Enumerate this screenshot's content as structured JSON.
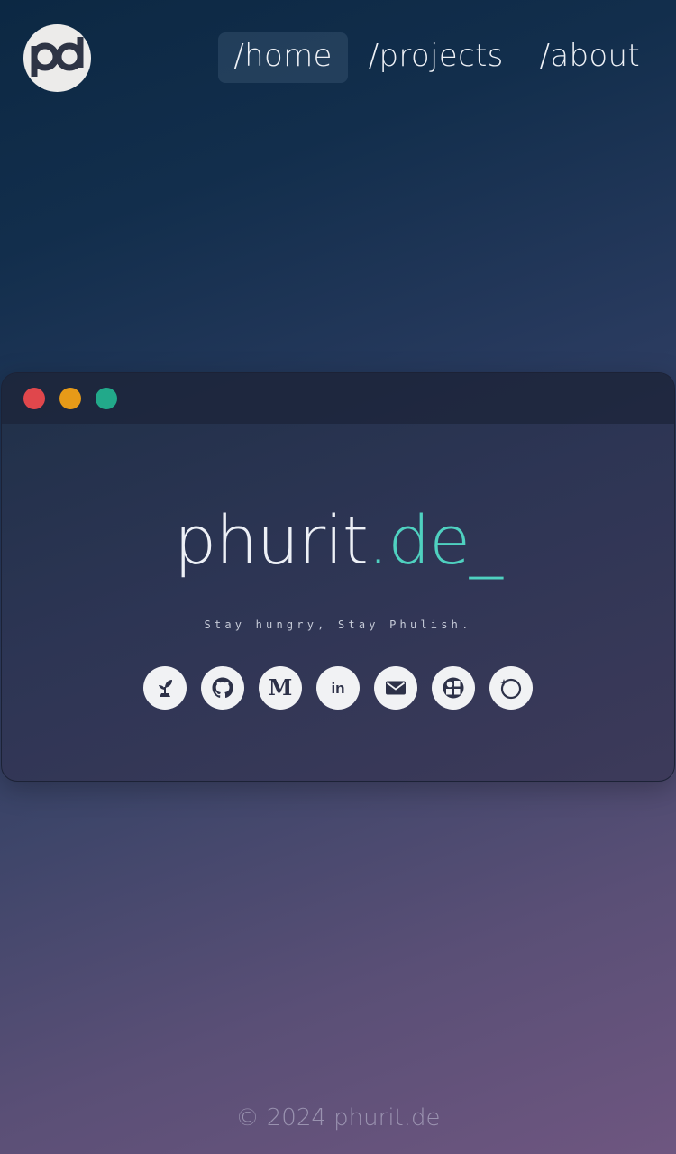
{
  "nav": {
    "items": [
      {
        "label": "/home",
        "active": true
      },
      {
        "label": "/projects",
        "active": false
      },
      {
        "label": "/about",
        "active": false
      }
    ]
  },
  "logo": {
    "icon": "pd-logo-icon"
  },
  "window": {
    "dots": [
      "#e0474c",
      "#e69a18",
      "#22a98a"
    ],
    "brand_main": "phurit",
    "brand_tld": ".de",
    "brand_cursor": "_",
    "tagline": "Stay hungry, Stay Phulish.",
    "socials": [
      {
        "icon": "sprout-icon"
      },
      {
        "icon": "github-icon"
      },
      {
        "icon": "medium-icon",
        "glyph": "M"
      },
      {
        "icon": "linkedin-icon",
        "glyph": "in"
      },
      {
        "icon": "mail-icon"
      },
      {
        "icon": "dashboard-icon"
      },
      {
        "icon": "orbit-icon"
      }
    ]
  },
  "footer": {
    "text": "© 2024 phurit.de"
  },
  "colors": {
    "accent": "#4fd1c0",
    "text": "#edf0f6",
    "icon_dark": "#2d3148"
  }
}
